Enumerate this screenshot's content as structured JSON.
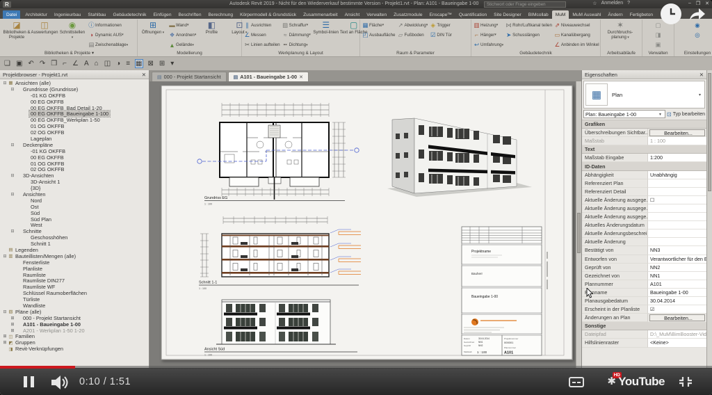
{
  "titlebar": {
    "logo": "R",
    "title": "Autodesk Revit 2019 - Nicht für den Wiederverkauf bestimmte Version - Projekt1.rvt - Plan: A101 - Baueingabe 1-00",
    "search_placeholder": "Stichwort oder Frage eingeben",
    "star": "☆",
    "signin": "Anmelden",
    "help": "?",
    "min": "–",
    "restore": "❐",
    "close": "✕"
  },
  "ribbon": {
    "tabs": [
      {
        "label": "Datei",
        "cls": "file"
      },
      {
        "label": "Architektur"
      },
      {
        "label": "Ingenieurbau"
      },
      {
        "label": "Stahlbau"
      },
      {
        "label": "Gebäudetechnik"
      },
      {
        "label": "Einfügen"
      },
      {
        "label": "Beschriften"
      },
      {
        "label": "Berechnung"
      },
      {
        "label": "Körpermodell & Grundstück"
      },
      {
        "label": "Zusammenarbeit"
      },
      {
        "label": "Ansicht"
      },
      {
        "label": "Verwalten"
      },
      {
        "label": "Zusatzmodule"
      },
      {
        "label": "Enscape™"
      },
      {
        "label": "Quantification"
      },
      {
        "label": "Site Designer"
      },
      {
        "label": "BIMcollab"
      },
      {
        "label": "MuM",
        "cls": "active"
      },
      {
        "label": "MuM Auswahl"
      },
      {
        "label": "Ändern"
      },
      {
        "label": "Fertigbeton"
      }
    ],
    "panels": [
      {
        "label": "Bibliotheken & Projekte ▾",
        "g0": [
          {
            "icon": "◪",
            "color": "#a8833f",
            "label": "Bibliotheken & Projekte",
            "arrow": ""
          },
          {
            "icon": "◫",
            "color": "#a8833f",
            "label": "Auswertungen",
            "arrow": ""
          },
          {
            "icon": "◉",
            "color": "#6d9940",
            "label": "Schnittstellen",
            "arrow": " ▾"
          }
        ],
        "g1": [
          {
            "icon": "ⓘ",
            "color": "#2f6ca8",
            "label": "Informationen",
            "arrow": ""
          },
          {
            "icon": "◑",
            "color": "#a83f3f",
            "label": "Dynamic AUS",
            "arrow": " ▾"
          },
          {
            "icon": "▤",
            "color": "#7a7a76",
            "label": "Zwischenablage",
            "arrow": " ▾"
          }
        ]
      },
      {
        "label": "Modellierung",
        "g0": [
          {
            "icon": "⊞",
            "color": "#2f6ca8",
            "label": "Öffnungen",
            "arrow": " ▾"
          }
        ],
        "g1": [
          {
            "icon": "▬",
            "color": "#8a7a55",
            "label": "Wand",
            "arrow": " ▾"
          },
          {
            "icon": "❖",
            "color": "#5f7da8",
            "label": "Anordnen",
            "arrow": " ▾"
          },
          {
            "icon": "▲",
            "color": "#5d8a3c",
            "label": "Gelände",
            "arrow": " ▾"
          }
        ],
        "g2": [
          {
            "icon": "◧",
            "color": "#56678a",
            "label": "Profile",
            "arrow": ""
          },
          {
            "icon": "⊡",
            "color": "#56678a",
            "label": "Layout",
            "arrow": " ▾"
          }
        ]
      },
      {
        "label": "Werkplanung & Layout",
        "g0": [
          {
            "icon": "∥",
            "color": "#2f6ca8",
            "label": "Ausrichten",
            "arrow": ""
          },
          {
            "icon": "∠",
            "color": "#2f6ca8",
            "label": "Messen",
            "arrow": ""
          },
          {
            "icon": "✂",
            "color": "#555550",
            "label": "Linien aufteilen",
            "arrow": ""
          }
        ],
        "g1": [
          {
            "icon": "▨",
            "color": "#7a7a76",
            "label": "Schraffur",
            "arrow": " ▾"
          },
          {
            "icon": "≈",
            "color": "#7a7a76",
            "label": "Dämmung",
            "arrow": " ▾"
          },
          {
            "icon": "╍",
            "color": "#55504b",
            "label": "Dichtung",
            "arrow": " ▾"
          }
        ],
        "g2": [
          {
            "icon": "☰",
            "color": "#2f6ca8",
            "label": "Symbol-linien",
            "arrow": ""
          },
          {
            "icon": "▢",
            "color": "#2a8a86",
            "label": "Text an Fläche",
            "arrow": ""
          }
        ]
      },
      {
        "label": "Raum & Parameter",
        "g0": [
          {
            "icon": "▦",
            "color": "#2f6ca8",
            "label": "Fläche",
            "arrow": " ▾"
          },
          {
            "icon": "◰",
            "color": "#2f6ca8",
            "label": "Ausbaufläche",
            "arrow": ""
          }
        ],
        "g1": [
          {
            "icon": "↗",
            "color": "#7a7a76",
            "label": "Abwicklung",
            "arrow": " ▾"
          },
          {
            "icon": "▱",
            "color": "#7a7a76",
            "label": "Fußboden",
            "arrow": ""
          }
        ],
        "g2": [
          {
            "icon": "◈",
            "color": "#bd9a2e",
            "label": "Trigger",
            "arrow": ""
          },
          {
            "icon": "☑",
            "color": "#2f6ca8",
            "label": "DIN Tür",
            "arrow": ""
          }
        ]
      },
      {
        "label": "Gebäudetechnik",
        "g0": [
          {
            "icon": "▥",
            "color": "#a83f30",
            "label": "Heizung",
            "arrow": " ▾"
          },
          {
            "icon": "⌐",
            "color": "#a8713f",
            "label": "Hänger",
            "arrow": " ▾"
          },
          {
            "icon": "↩",
            "color": "#2f6ca8",
            "label": "Umfahrung",
            "arrow": " ▾"
          }
        ],
        "g1": [
          {
            "icon": "⋈",
            "color": "#7a7a76",
            "label": "Rohr/Luftkanal teilen",
            "arrow": ""
          },
          {
            "icon": "➤",
            "color": "#2f6ca8",
            "label": "Schusslängen",
            "arrow": ""
          }
        ],
        "g2": [
          {
            "icon": "⇗",
            "color": "#a83f30",
            "label": "Niveauwechsel",
            "arrow": ""
          },
          {
            "icon": "▭",
            "color": "#a8713f",
            "label": "Kanalübergang",
            "arrow": ""
          },
          {
            "icon": "∠",
            "color": "#a83f30",
            "label": "Anbinden im Winkel",
            "arrow": ""
          }
        ]
      },
      {
        "label": "Arbeitsabläufe",
        "g0": [
          {
            "icon": "✶",
            "color": "#7a7a76",
            "label": "Durchbruchs-planung",
            "arrow": " ▾"
          }
        ]
      },
      {
        "label": "Verwalten",
        "g0": [
          {
            "icon": "▢",
            "color": "#8a8a86",
            "label": "",
            "arrow": ""
          },
          {
            "icon": "◨",
            "color": "#8a8a86",
            "label": "",
            "arrow": ""
          },
          {
            "icon": "▣",
            "color": "#8a8a86",
            "label": "",
            "arrow": ""
          }
        ]
      },
      {
        "label": "Einstellungen",
        "g0": [
          {
            "icon": "◉",
            "color": "#2f6ca8",
            "label": "",
            "arrow": ""
          },
          {
            "icon": "◎",
            "color": "#2f6ca8",
            "label": "",
            "arrow": ""
          }
        ]
      }
    ]
  },
  "quick_access": [
    {
      "name": "open-icon",
      "glyph": "❏"
    },
    {
      "name": "save-icon",
      "glyph": "▣"
    },
    {
      "name": "undo-icon",
      "glyph": "↶"
    },
    {
      "name": "redo-icon",
      "glyph": "↷"
    },
    {
      "name": "print-icon",
      "glyph": "❒"
    },
    {
      "name": "measure-icon",
      "glyph": "⌐"
    },
    {
      "name": "aligned-dimension-icon",
      "glyph": "∠"
    },
    {
      "name": "text-icon",
      "glyph": "A"
    },
    {
      "name": "default-3d-view-icon",
      "glyph": "⌂"
    },
    {
      "name": "section-icon",
      "glyph": "◫"
    },
    {
      "name": "render-icon",
      "glyph": "◑"
    },
    {
      "name": "thin-lines-icon",
      "glyph": "≡"
    },
    {
      "name": "properties-icon",
      "glyph": "▦",
      "cls": "hl"
    },
    {
      "name": "close-hidden-windows-icon",
      "glyph": "⊠"
    },
    {
      "name": "switch-windows-icon",
      "glyph": "⊞"
    },
    {
      "name": "customize-icon",
      "glyph": "▾"
    }
  ],
  "view_tabs": [
    {
      "icon": "▤",
      "label": "000 - Projekt Startansicht"
    },
    {
      "icon": "▤",
      "label": "A101 - Baueingabe 1-00",
      "close": "✕"
    }
  ],
  "project_browser": {
    "title": "Projektbrowser - Projekt1.rvt",
    "close": "✕",
    "tree": [
      {
        "exp": "⊟",
        "icon": "▦",
        "label": "Ansichten (alle)",
        "cls": "d0"
      },
      {
        "exp": "⊟",
        "icon": "",
        "label": "Grundrisse (Grundrisse)",
        "cls": "d1"
      },
      {
        "exp": "",
        "icon": "",
        "label": "-01 KG OKFFB",
        "cls": "d2"
      },
      {
        "exp": "",
        "icon": "",
        "label": "00 EG OKFFB",
        "cls": "d2"
      },
      {
        "exp": "",
        "icon": "",
        "label": "00 EG OKFFB_Bad Detail 1-20",
        "cls": "d2"
      },
      {
        "exp": "",
        "icon": "",
        "label": "00 EG OKFFB_Baueingabe 1-100",
        "cls": "d2 sel"
      },
      {
        "exp": "",
        "icon": "",
        "label": "00 EG OKFFB_Werkplan 1-50",
        "cls": "d2"
      },
      {
        "exp": "",
        "icon": "",
        "label": "01 OG OK­FFB",
        "cls": "d2"
      },
      {
        "exp": "",
        "icon": "",
        "label": "02 OG OKFFB",
        "cls": "d2"
      },
      {
        "exp": "",
        "icon": "",
        "label": "Lageplan",
        "cls": "d2"
      },
      {
        "exp": "⊟",
        "icon": "",
        "label": "Deckenpläne",
        "cls": "d1"
      },
      {
        "exp": "",
        "icon": "",
        "label": "-01 KG OKFFB",
        "cls": "d2"
      },
      {
        "exp": "",
        "icon": "",
        "label": "00 EG OKFFB",
        "cls": "d2"
      },
      {
        "exp": "",
        "icon": "",
        "label": "01 OG OKFFB",
        "cls": "d2"
      },
      {
        "exp": "",
        "icon": "",
        "label": "02 OG OKFFB",
        "cls": "d2"
      },
      {
        "exp": "⊟",
        "icon": "",
        "label": "3D-Ansichten",
        "cls": "d1"
      },
      {
        "exp": "",
        "icon": "",
        "label": "3D-Ansicht 1",
        "cls": "d2"
      },
      {
        "exp": "",
        "icon": "",
        "label": "{3D}",
        "cls": "d2"
      },
      {
        "exp": "⊟",
        "icon": "",
        "label": "Ansichten",
        "cls": "d1"
      },
      {
        "exp": "",
        "icon": "",
        "label": "Nord",
        "cls": "d2"
      },
      {
        "exp": "",
        "icon": "",
        "label": "Ost",
        "cls": "d2"
      },
      {
        "exp": "",
        "icon": "",
        "label": "Süd",
        "cls": "d2"
      },
      {
        "exp": "",
        "icon": "",
        "label": "Süd Plan",
        "cls": "d2"
      },
      {
        "exp": "",
        "icon": "",
        "label": "West",
        "cls": "d2"
      },
      {
        "exp": "⊟",
        "icon": "",
        "label": "Schnitte",
        "cls": "d1"
      },
      {
        "exp": "",
        "icon": "",
        "label": "Geschosshöhen",
        "cls": "d2"
      },
      {
        "exp": "",
        "icon": "",
        "label": "Schnitt 1",
        "cls": "d2"
      },
      {
        "exp": "",
        "icon": "▤",
        "label": "Legenden",
        "cls": "d0"
      },
      {
        "exp": "⊟",
        "icon": "▥",
        "label": "Bauteillisten/Mengen (alle)",
        "cls": "d0"
      },
      {
        "exp": "",
        "icon": "",
        "label": "Fensterliste",
        "cls": "d1"
      },
      {
        "exp": "",
        "icon": "",
        "label": "Planliste",
        "cls": "d1"
      },
      {
        "exp": "",
        "icon": "",
        "label": "Raumliste",
        "cls": "d1"
      },
      {
        "exp": "",
        "icon": "",
        "label": "Raumliste DIN277",
        "cls": "d1"
      },
      {
        "exp": "",
        "icon": "",
        "label": "Raumliste WF",
        "cls": "d1"
      },
      {
        "exp": "",
        "icon": "",
        "label": "Schlüssel Raumoberflächen",
        "cls": "d1"
      },
      {
        "exp": "",
        "icon": "",
        "label": "Türliste",
        "cls": "d1"
      },
      {
        "exp": "",
        "icon": "",
        "label": "Wandliste",
        "cls": "d1"
      },
      {
        "exp": "⊟",
        "icon": "▧",
        "label": "Pläne (alle)",
        "cls": "d0"
      },
      {
        "exp": "⊞",
        "icon": "",
        "label": "000 - Projekt Startansicht",
        "cls": "d1"
      },
      {
        "exp": "⊞",
        "icon": "",
        "label": "A101 - Baueingabe 1-00",
        "cls": "d1 bold"
      },
      {
        "exp": "⊞",
        "icon": "",
        "label": "A201 - Werkplan 1-50 1-20",
        "cls": "d1 dim2"
      },
      {
        "exp": "⊞",
        "icon": "◫",
        "label": "Familien",
        "cls": "d0"
      },
      {
        "exp": "⊞",
        "icon": "◩",
        "label": "Gruppen",
        "cls": "d0"
      },
      {
        "exp": "",
        "icon": "◨",
        "label": "Revit-Verknüpfungen",
        "cls": "d0"
      }
    ]
  },
  "sheet": {
    "plan_label": "Grundriss EG",
    "plan_scale": "1 : 100",
    "section_label": "Schnitt 1-1",
    "section_scale": "1 : 100",
    "elevation_label": "Ansicht Süd",
    "elevation_scale": "1 : 100",
    "titleblock": {
      "project": "Projektname",
      "client": "Bauherr",
      "sheet_title": "Baueingabe 1-00",
      "date_label": "Datum",
      "date": "30.04.2014",
      "drawn_label": "Gezeichnet",
      "drawn_by": "NN1",
      "checked_label": "Geprüft",
      "checked_by": "NN2",
      "scale_label": "Maßstab",
      "scale": "1 : 100",
      "projnum_label": "Projektnummer",
      "project_number": "000001",
      "sheetnum_label": "Plannummer",
      "sheet_number": "A101"
    }
  },
  "properties": {
    "title": "Eigenschaften",
    "close": "✕",
    "type_icon": "▦",
    "type_label": "Plan",
    "dd": "▾",
    "selector": "Plan: Baueingabe 1-00",
    "edit_icon": "⊡",
    "edit_type": "Typ bearbeiten",
    "rows": [
      {
        "cls": "group",
        "label": "Grafiken",
        "value": ""
      },
      {
        "label": "Überschreibungen Sichtbar...",
        "value": "Bearbeiten...",
        "cls_v": "btn"
      },
      {
        "label": "Maßstab",
        "value": "1 : 100",
        "cls": "dim"
      },
      {
        "cls": "group",
        "label": "Text",
        "value": ""
      },
      {
        "label": "Maßstab Eingabe",
        "value": "1:200"
      },
      {
        "cls": "group",
        "label": "ID-Daten",
        "value": ""
      },
      {
        "label": "Abhängigkeit",
        "value": "Unabhängig"
      },
      {
        "label": "Referenziert Plan",
        "value": ""
      },
      {
        "label": "Referenziert Detail",
        "value": ""
      },
      {
        "label": "Aktuelle Änderung ausgege...",
        "value": "☐"
      },
      {
        "label": "Aktuelle Änderung ausgege...",
        "value": ""
      },
      {
        "label": "Aktuelle Änderung ausgege...",
        "value": ""
      },
      {
        "label": "Aktuelles Änderungsdatum",
        "value": ""
      },
      {
        "label": "Aktuelle Änderungsbeschrei...",
        "value": ""
      },
      {
        "label": "Aktuelle Änderung",
        "value": ""
      },
      {
        "label": "Bestätigt von",
        "value": "NN3"
      },
      {
        "label": "Entworfen von",
        "value": "Verantwortlicher für den Ent..."
      },
      {
        "label": "Geprüft von",
        "value": "NN2"
      },
      {
        "label": "Gezeichnet von",
        "value": "NN1"
      },
      {
        "label": "Plannummer",
        "value": "A101"
      },
      {
        "label": "Planname",
        "value": "Baueingabe 1-00"
      },
      {
        "label": "Planausgabedatum",
        "value": "30.04.2014"
      },
      {
        "label": "Erscheint in der Planliste",
        "value": "☑"
      },
      {
        "label": "Änderungen an Plan",
        "value": "Bearbeiten...",
        "cls_v": "btn"
      },
      {
        "cls": "group",
        "label": "Sonstige",
        "value": ""
      },
      {
        "label": "Dateipfad",
        "value": "D:\\_MuM\\BimBooster-Video...",
        "cls": "dim"
      },
      {
        "label": "Hilfslinienraster",
        "value": "<Keine>"
      }
    ]
  },
  "player": {
    "time": "0:10 / 1:51",
    "progress_pct": 10.5,
    "logo": "YouTube",
    "hd_badge": "HD",
    "gear": "✱"
  }
}
